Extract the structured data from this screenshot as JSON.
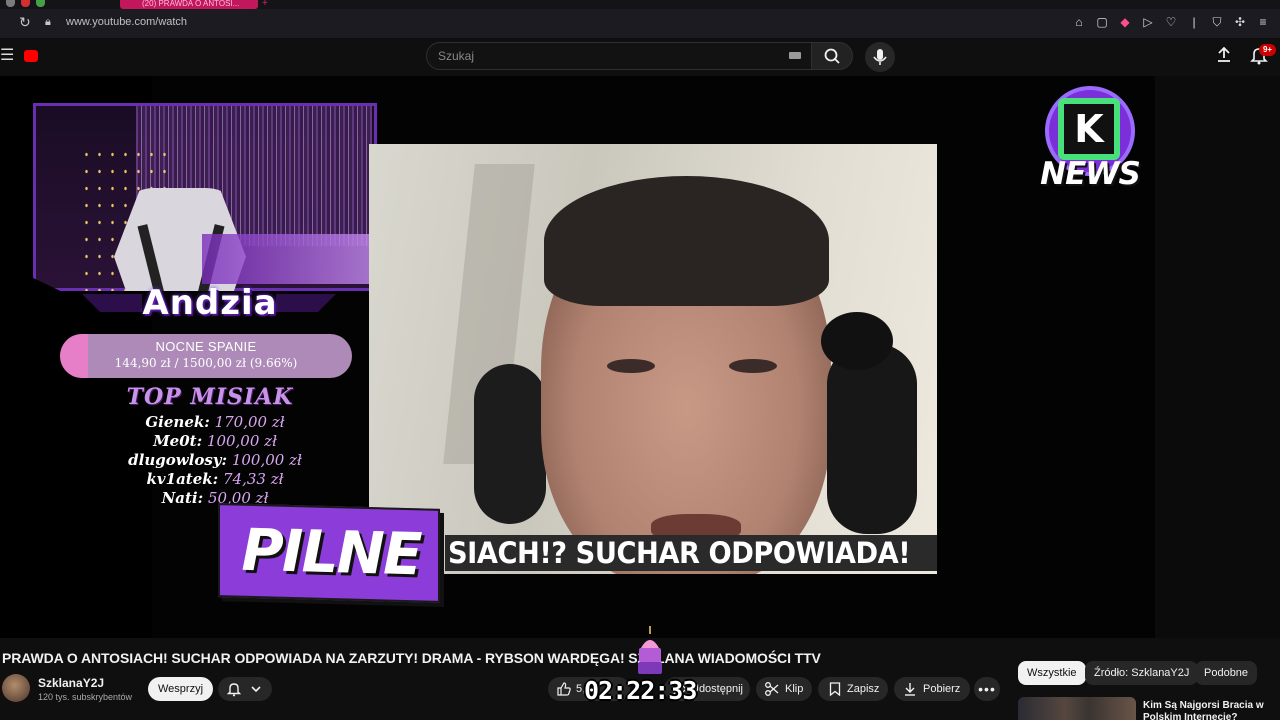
{
  "browser": {
    "active_tab_title": "(20) PRAWDA O ANTOSI...",
    "url": "www.youtube.com/watch"
  },
  "header": {
    "search_placeholder": "Szukaj",
    "notification_count": "9+"
  },
  "overlay": {
    "streamer_name": "Andzia",
    "goal": {
      "title": "NOCNE SPANIE",
      "progress_text": "144,90 zł  /  1500,00 zł (9.66%)",
      "progress_fraction": 0.0966
    },
    "top_title": "TOP MISIAK",
    "top_donors": [
      {
        "name": "Gienek:",
        "amount": "170,00 zł"
      },
      {
        "name": "Me0t:",
        "amount": "100,00 zł"
      },
      {
        "name": "dlugowlosy:",
        "amount": "100,00 zł"
      },
      {
        "name": "kv1atek:",
        "amount": "74,33 zł"
      },
      {
        "name": "Nati:",
        "amount": "50,00 zł"
      }
    ],
    "badge_text": "PILNE",
    "subtitle_text": "SIACH!? SUCHAR ODPOWIADA!",
    "logo_text": "NEWS"
  },
  "video": {
    "title": "PRAWDA O ANTOSIACH! SUCHAR ODPOWIADA NA ZARZUTY! DRAMA - RYBSON WARDĘGA! SZKLANA WIADOMOŚCI TTV",
    "channel_name": "SzklanaY2J",
    "subscribers": "120 tys. subskrybentów",
    "support_label": "Wesprzyj",
    "like_count": "5,7",
    "share_label": "Udostępnij",
    "clip_label": "Klip",
    "save_label": "Zapisz",
    "download_label": "Pobierz",
    "more_label": "•••",
    "timer": "02:22:33"
  },
  "related": {
    "chips": [
      "Wszystkie",
      "Źródło: SzklanaY2J",
      "Podobne"
    ],
    "first_title": "Kim Są Najgorsi Bracia w Polskim Internecie?"
  },
  "colors": {
    "accent_purple": "#8c3cd8",
    "goal_pink": "#e67fc7",
    "yt_red": "#ff0000"
  }
}
